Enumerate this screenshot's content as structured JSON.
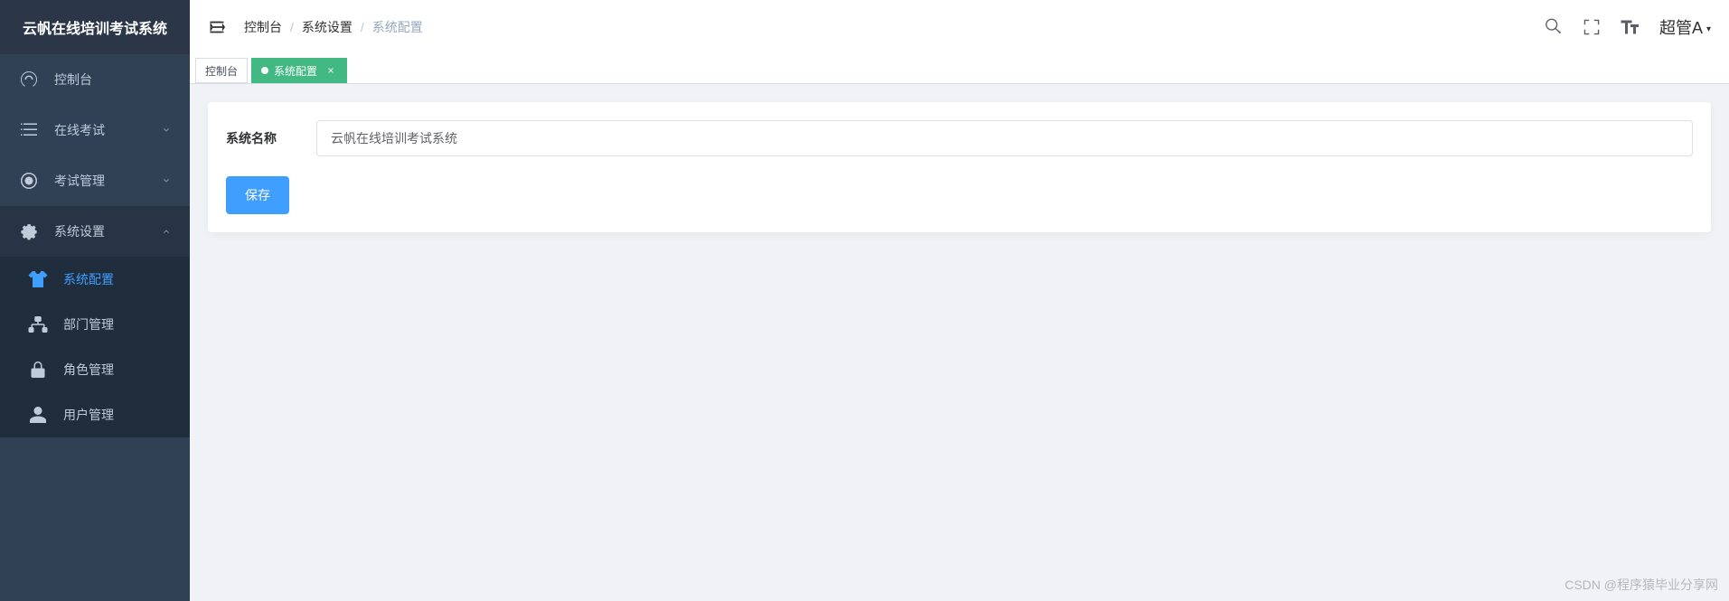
{
  "app_title": "云帆在线培训考试系统",
  "breadcrumb": [
    "控制台",
    "系统设置",
    "系统配置"
  ],
  "header": {
    "user_name": "超管A"
  },
  "sidebar": {
    "items": [
      {
        "label": "控制台",
        "icon": "dashboard"
      },
      {
        "label": "在线考试",
        "icon": "list",
        "has_children": true
      },
      {
        "label": "考试管理",
        "icon": "target",
        "has_children": true
      },
      {
        "label": "系统设置",
        "icon": "gear",
        "has_children": true,
        "expanded": true,
        "children": [
          {
            "label": "系统配置",
            "icon": "shirt",
            "active": true
          },
          {
            "label": "部门管理",
            "icon": "sitemap"
          },
          {
            "label": "角色管理",
            "icon": "lock"
          },
          {
            "label": "用户管理",
            "icon": "user"
          }
        ]
      }
    ]
  },
  "tabs": [
    {
      "label": "控制台",
      "active": false,
      "closable": false
    },
    {
      "label": "系统配置",
      "active": true,
      "closable": true
    }
  ],
  "form": {
    "system_name_label": "系统名称",
    "system_name_value": "云帆在线培训考试系统",
    "save_label": "保存"
  },
  "watermark": "CSDN @程序猿毕业分享网"
}
